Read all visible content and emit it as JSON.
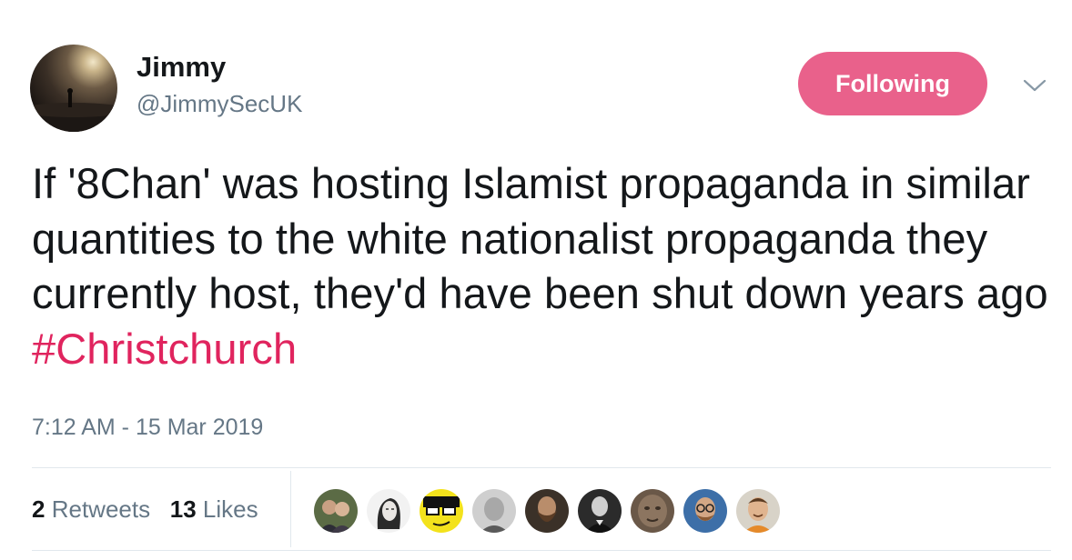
{
  "author": {
    "name": "Jimmy",
    "handle": "@JimmySecUK"
  },
  "follow_button": {
    "label": "Following",
    "color": "#e0245e"
  },
  "tweet": {
    "text_before": "If '8Chan' was hosting Islamist propaganda in similar quantities to the white nationalist propaganda they currently host, they'd have been shut down years ago ",
    "hashtag": "#Christchurch",
    "timestamp": "7:12 AM - 15 Mar 2019"
  },
  "stats": {
    "retweets_count": "2",
    "retweets_label": "Retweets",
    "likes_count": "13",
    "likes_label": "Likes"
  },
  "likers": [
    {
      "icon": "liker-avatar-couple"
    },
    {
      "icon": "liker-avatar-sketch"
    },
    {
      "icon": "liker-avatar-cartoon"
    },
    {
      "icon": "liker-avatar-man"
    },
    {
      "icon": "liker-avatar-bearded"
    },
    {
      "icon": "liker-avatar-suit"
    },
    {
      "icon": "liker-avatar-statue"
    },
    {
      "icon": "liker-avatar-glasses"
    },
    {
      "icon": "liker-avatar-smiling"
    }
  ]
}
